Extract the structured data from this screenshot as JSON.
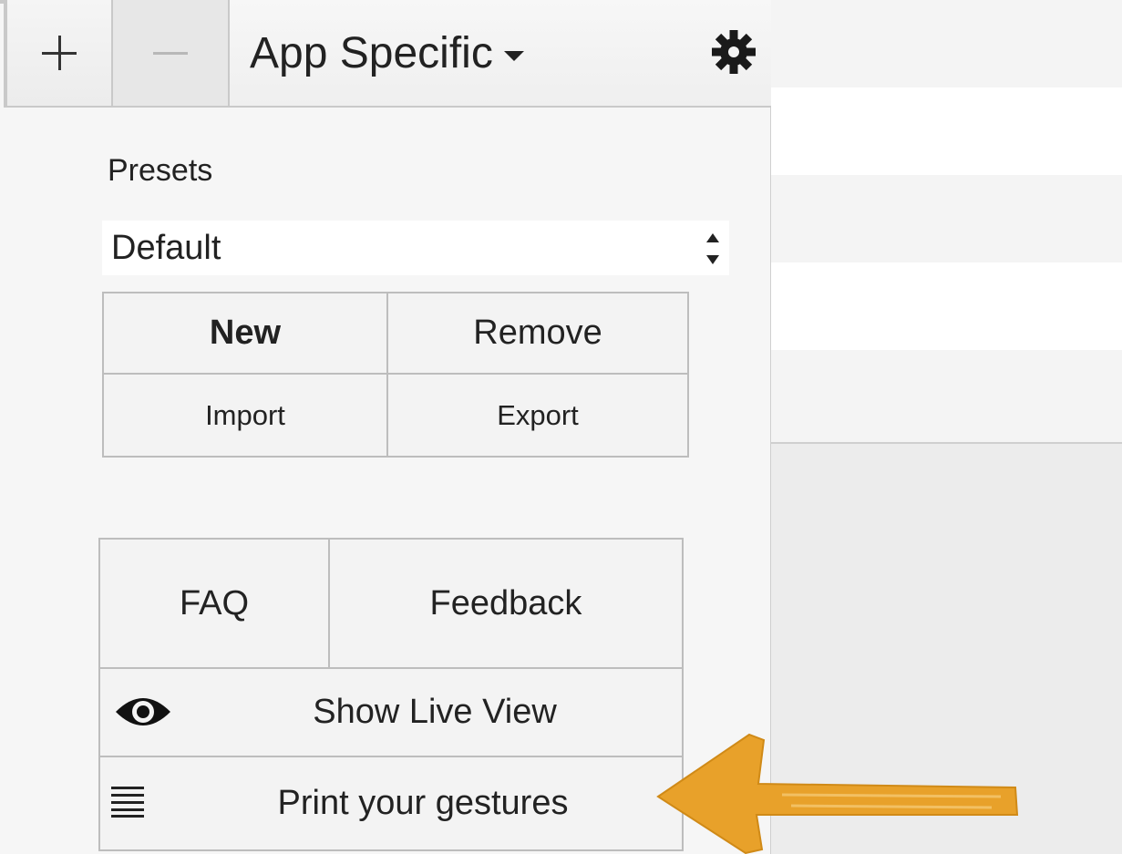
{
  "toolbar": {
    "add_icon": "plus-icon",
    "remove_icon": "minus-icon",
    "scope_label": "App Specific",
    "settings_icon": "gear-icon"
  },
  "presets": {
    "label": "Presets",
    "selected": "Default",
    "buttons": {
      "new": "New",
      "remove": "Remove",
      "import": "Import",
      "export": "Export"
    }
  },
  "help": {
    "faq": "FAQ",
    "feedback": "Feedback",
    "live_view": "Show Live View",
    "live_view_icon": "eye-icon",
    "print": "Print your gestures",
    "print_icon": "lines-icon"
  },
  "annotation": {
    "arrow_color": "#e8a12a"
  }
}
